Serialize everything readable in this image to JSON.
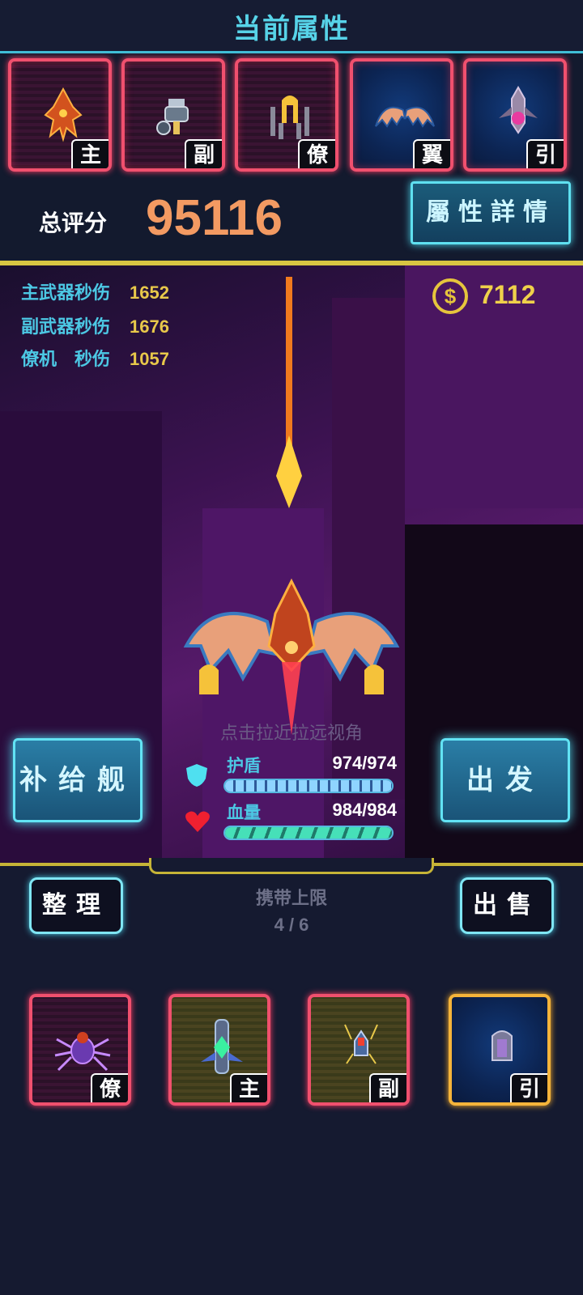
{
  "header": {
    "title": "当前属性"
  },
  "equipment_slots": [
    {
      "tag": "主",
      "icon": "main-weapon-icon"
    },
    {
      "tag": "副",
      "icon": "sub-weapon-icon"
    },
    {
      "tag": "僚",
      "icon": "wingman-icon"
    },
    {
      "tag": "翼",
      "icon": "wing-icon"
    },
    {
      "tag": "引",
      "icon": "engine-icon"
    }
  ],
  "score": {
    "label": "总评分",
    "value": "95116"
  },
  "detail_button": {
    "label": "屬性詳情"
  },
  "stats": [
    {
      "label": "主武器秒伤",
      "value": "1652"
    },
    {
      "label": "副武器秒伤",
      "value": "1676"
    },
    {
      "label": "僚机　秒伤",
      "value": "1057"
    }
  ],
  "coins": {
    "value": "7112",
    "symbol": "$"
  },
  "scene": {
    "hint": "点击拉近拉远视角"
  },
  "supply_button": {
    "label": "补给舰"
  },
  "depart_button": {
    "label": "出发"
  },
  "shield": {
    "label": "护盾",
    "value": "974/974",
    "fraction": 1.0
  },
  "hp": {
    "label": "血量",
    "value": "984/984",
    "fraction": 1.0
  },
  "inventory": {
    "sort_button": "整理",
    "sell_button": "出售",
    "capacity_label": "携带上限",
    "capacity_value": "4 / 6",
    "items": [
      {
        "tag": "僚",
        "icon": "spider-wingman-icon"
      },
      {
        "tag": "主",
        "icon": "crystal-cannon-icon"
      },
      {
        "tag": "副",
        "icon": "missile-pod-icon"
      },
      {
        "tag": "引",
        "icon": "thruster-icon"
      }
    ]
  },
  "colors": {
    "accent": "#57d3e8",
    "score": "#f39a62",
    "gold": "#e6c53c",
    "slot_border": "#f0506e"
  }
}
